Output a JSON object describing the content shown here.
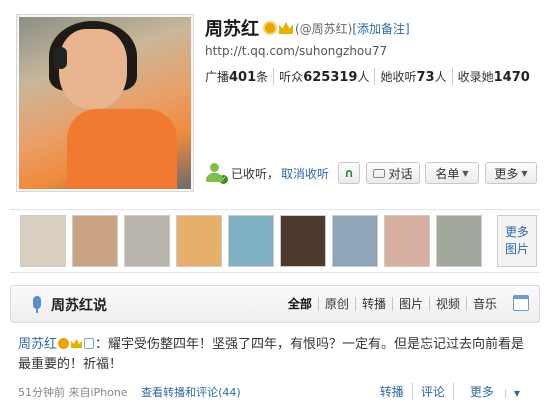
{
  "profile": {
    "name": "周苏红",
    "handle": "(@周苏红)",
    "add_note": "[添加备注]",
    "url": "http://t.qq.com/suhongzhou77",
    "stats": [
      {
        "label": "广播",
        "value": "401",
        "unit": "条"
      },
      {
        "label": "听众",
        "value": "625319",
        "unit": "人"
      },
      {
        "label": "她收听",
        "value": "73",
        "unit": "人"
      },
      {
        "label": "收录她",
        "value": "1470",
        "unit": ""
      }
    ],
    "follow_status": "已收听",
    "unfollow": "取消收听"
  },
  "actions": {
    "listen": "∩",
    "dialog": "对话",
    "list": "名单",
    "more": "更多"
  },
  "photos": {
    "more_line1": "更多",
    "more_line2": "图片",
    "thumb_colors": [
      "#d8cfc0",
      "#c9a383",
      "#b9b4ac",
      "#e6b06c",
      "#7fb0c4",
      "#4e3a2c",
      "#8fa6b8",
      "#d7b0a2",
      "#a3a89c"
    ]
  },
  "feed": {
    "title": "周苏红说",
    "tabs": [
      "全部",
      "原创",
      "转播",
      "图片",
      "视频",
      "音乐"
    ]
  },
  "post": {
    "author": "周苏红",
    "text": "：耀宇受伤整四年！坚强了四年，有恨吗？一定有。但是忘记过去向前看是最重要的！祈福！",
    "time": "51分钟前",
    "source": "来自iPhone",
    "comments": "查看转播和评论(44)",
    "actions": [
      "转播",
      "评论",
      "更多"
    ]
  }
}
